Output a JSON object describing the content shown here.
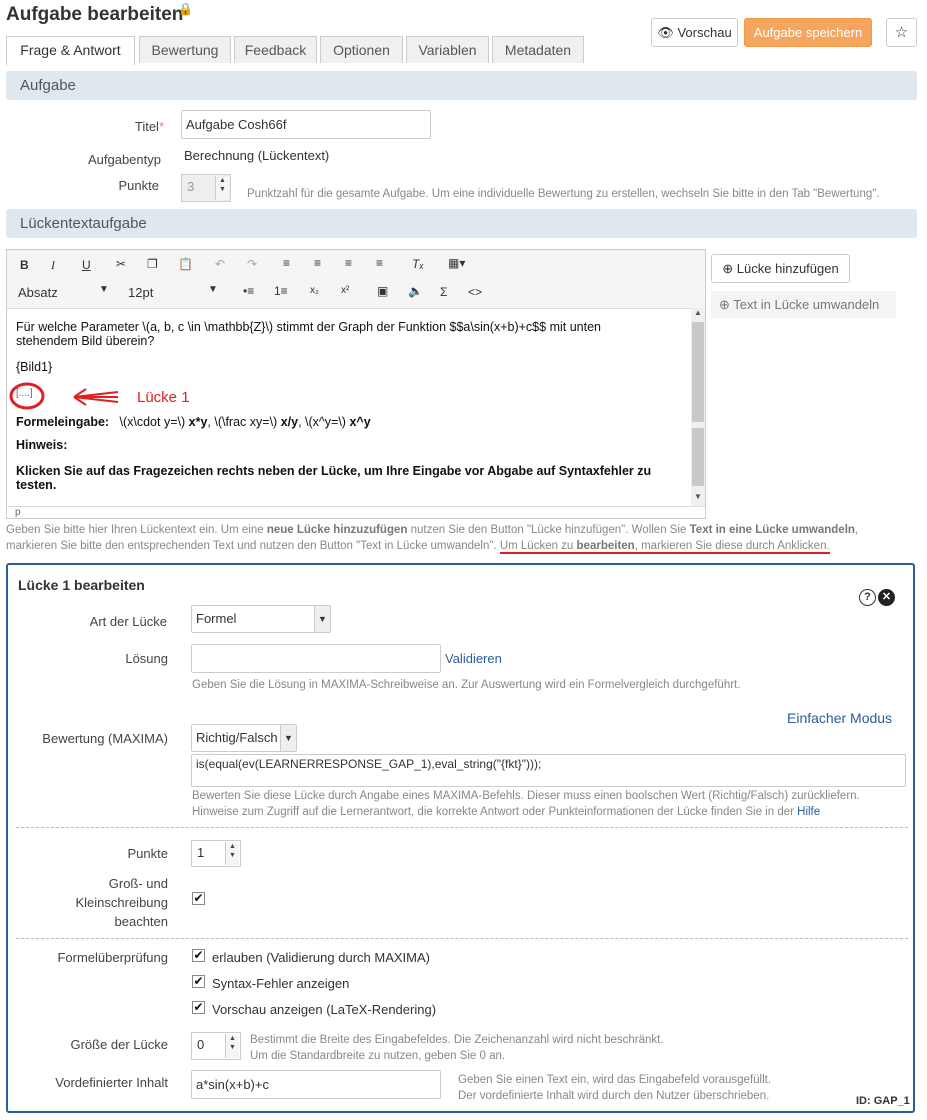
{
  "header": {
    "title": "Aufgabe bearbeiten",
    "preview_label": "Vorschau",
    "save_label": "Aufgabe speichern",
    "star_icon": "star-icon"
  },
  "tabs": [
    {
      "label": "Frage & Antwort",
      "active": true
    },
    {
      "label": "Bewertung"
    },
    {
      "label": "Feedback"
    },
    {
      "label": "Optionen"
    },
    {
      "label": "Variablen"
    },
    {
      "label": "Metadaten"
    }
  ],
  "aufgabe": {
    "section_title": "Aufgabe",
    "title_label": "Titel",
    "title_value": "Aufgabe Cosh66f",
    "type_label": "Aufgabentyp",
    "type_value": "Berechnung (Lückentext)",
    "points_label": "Punkte",
    "points_value": "3",
    "points_help": "Punktzahl für die gesamte Aufgabe. Um eine individuelle Bewertung zu erstellen, wechseln Sie bitte in den Tab \"Bewertung\"."
  },
  "lueckentext": {
    "section_title": "Lückentextaufgabe",
    "format_select": "Absatz",
    "size_select": "12pt",
    "add_gap_label": "Lücke hinzufügen",
    "convert_label": "Text in Lücke umwandeln",
    "content_line1": "Für welche Parameter \\(a, b, c \\in \\mathbb{Z}\\) stimmt der Graph der Funktion $$a\\sin(x+b)+c$$ mit unten",
    "content_line2": "stehendem Bild überein?",
    "bild": "{Bild1}",
    "gap_marker": "[....]",
    "annotation": "Lücke 1",
    "formel_label": "Formeleingabe:",
    "formel_t1": "\\(x\\cdot y=\\) ",
    "formel_b1": "x*y",
    "formel_t2": ", \\(\\frac xy=\\) ",
    "formel_b2": "x/y",
    "formel_t3": ", \\(x^y=\\) ",
    "formel_b3": "x^y",
    "hinweis": "Hinweis:",
    "bold_line1": "Klicken Sie auf das Fragezeichen rechts neben der Lücke, um Ihre Eingabe vor Abgabe auf Syntaxfehler zu",
    "bold_line2": "testen.",
    "status_path": "p",
    "help_p1": "Geben Sie bitte hier Ihren Lückentext ein. Um eine ",
    "help_b1": "neue Lücke hinzuzufügen",
    "help_p2": " nutzen Sie den Button \"Lücke hinzufügen\". Wollen Sie ",
    "help_b2": "Text in eine Lücke umwandeln",
    "help_p3": ",",
    "help_p4": "markieren Sie bitte den entsprechenden Text und nutzen den Button \"Text in Lücke umwandeln\". ",
    "help_u1": "Um Lücken zu ",
    "help_b3": "bearbeiten",
    "help_u2": ", markieren Sie diese durch Anklicken."
  },
  "gap": {
    "title": "Lücke 1 bearbeiten",
    "art_label": "Art der Lücke",
    "art_value": "Formel",
    "loesung_label": "Lösung",
    "loesung_value": "",
    "validate_label": "Validieren",
    "loesung_help": "Geben Sie die Lösung in MAXIMA-Schreibweise an. Zur Auswertung wird ein Formelvergleich durchgeführt.",
    "simple_mode": "Einfacher Modus",
    "bewertung_label": "Bewertung (MAXIMA)",
    "bewertung_select": "Richtig/Falsch",
    "bewertung_code": "is(equal(ev(LEARNERRESPONSE_GAP_1),eval_string(\"{fkt}\")));",
    "bewertung_help1": "Bewerten Sie diese Lücke durch Angabe eines MAXIMA-Befehls. Dieser muss einen boolschen Wert (Richtig/Falsch) zurückliefern.",
    "bewertung_help2": "Hinweise zum Zugriff auf die Lernerantwort, die korrekte Antwort oder Punkteinformationen der Lücke finden Sie in der ",
    "bewertung_help_link": "Hilfe",
    "punkte_label": "Punkte",
    "punkte_value": "1",
    "case_label1": "Groß- und",
    "case_label2": "Kleinschreibung",
    "case_label3": "beachten",
    "formel_label": "Formelüberprüfung",
    "opt1": "erlauben (Validierung durch MAXIMA)",
    "opt2": "Syntax-Fehler anzeigen",
    "opt3": "Vorschau anzeigen (LaTeX-Rendering)",
    "size_label": "Größe der Lücke",
    "size_value": "0",
    "size_help1": "Bestimmt die Breite des Eingabefeldes. Die Zeichenanzahl wird nicht beschränkt.",
    "size_help2": "Um die Standardbreite zu nutzen, geben Sie 0 an.",
    "predef_label": "Vordefinierter Inhalt",
    "predef_value": "a*sin(x+b)+c",
    "predef_help1": "Geben Sie einen Text ein, wird das Eingabefeld vorausgefüllt.",
    "predef_help2": "Der vordefinierte Inhalt wird durch den Nutzer überschrieben.",
    "id_label": "ID: GAP_1"
  },
  "colors": {
    "accent": "#f5a55c",
    "link": "#2a5d9c",
    "annotation": "#e02020",
    "section_bg": "#dfe7ef"
  }
}
